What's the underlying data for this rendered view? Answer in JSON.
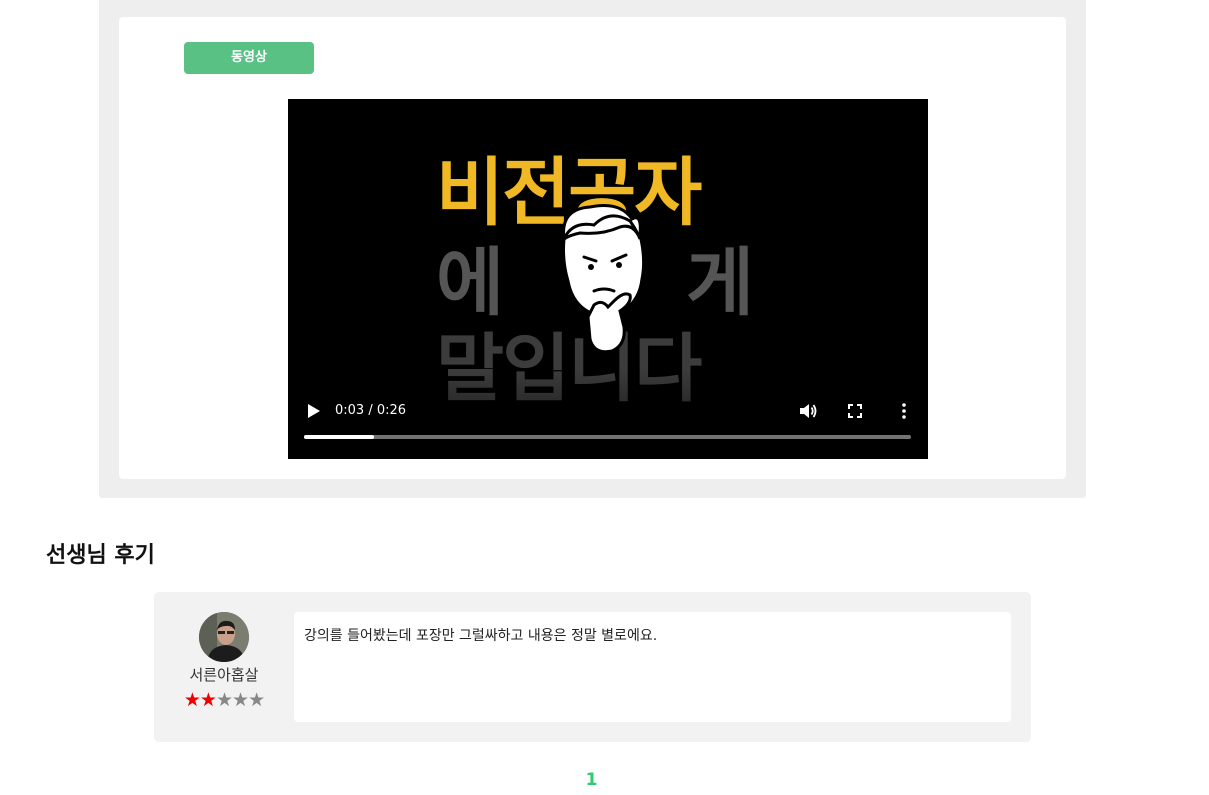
{
  "video": {
    "badge": "동영상",
    "thumbnail": {
      "line1": "비전공자",
      "line2_left": "에",
      "line2_right": "게",
      "line3": "말입니다"
    },
    "time": "0:03 / 0:26",
    "progress": 0.115,
    "controls": [
      "play-icon",
      "volume-icon",
      "fullscreen-icon",
      "more-options-icon"
    ]
  },
  "reviews": {
    "heading": "선생님 후기",
    "items": [
      {
        "name": "서른아홉살",
        "rating": 2,
        "max_rating": 5,
        "text": "강의를 들어봤는데 포장만 그럴싸하고 내용은 정말 별로에요."
      }
    ]
  },
  "pagination": {
    "current": "1"
  },
  "colors": {
    "badge": "#59c184",
    "star_on": "#ee0000",
    "star_off": "#888888",
    "page_number": "#2ecc71",
    "thumb_title": "#f0b825"
  }
}
